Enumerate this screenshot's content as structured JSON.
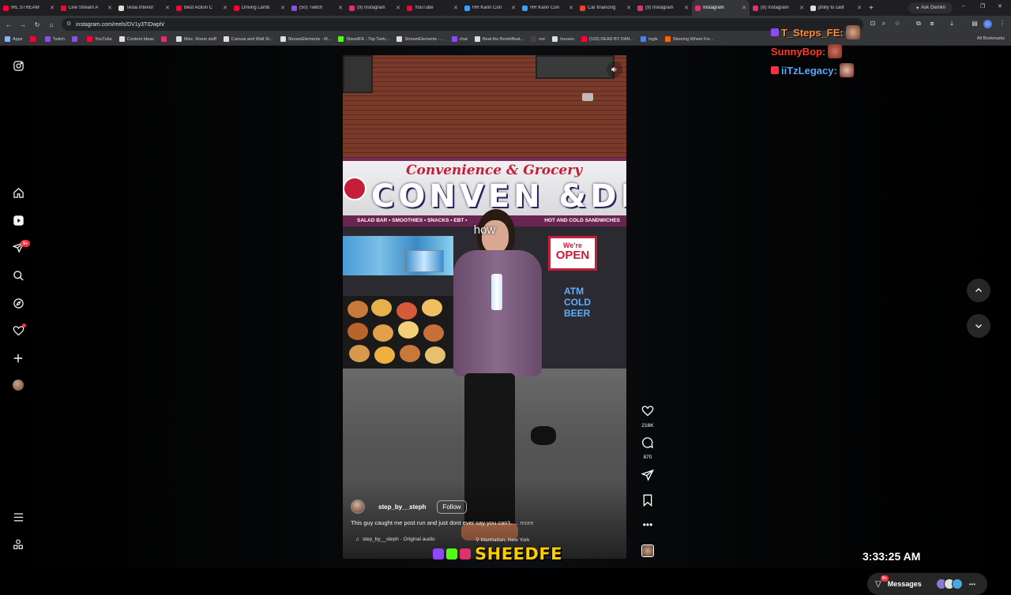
{
  "browser": {
    "tabs": [
      {
        "title": "IRL STREAM",
        "color": "#ff0033"
      },
      {
        "title": "Live Stream A",
        "color": "#ff0033"
      },
      {
        "title": "Tesla Interior",
        "color": "#dddddd"
      },
      {
        "title": "Best Action C",
        "color": "#ff0033"
      },
      {
        "title": "Driving Lamb",
        "color": "#ff0033"
      },
      {
        "title": "(50) Twitch",
        "color": "#9146ff"
      },
      {
        "title": "(9) Instagram",
        "color": "#e1306c"
      },
      {
        "title": "YouTube",
        "color": "#ff0033"
      },
      {
        "title": "HR Karin Con",
        "color": "#3aa0ff"
      },
      {
        "title": "HR Karin Con",
        "color": "#3aa0ff"
      },
      {
        "title": "Car financing",
        "color": "#ea4335"
      },
      {
        "title": "(9) Instagram",
        "color": "#e1306c"
      },
      {
        "title": "Instagram",
        "color": "#e1306c",
        "active": true
      },
      {
        "title": "(9) Instagram",
        "color": "#e1306c"
      },
      {
        "title": "philly to calif",
        "color": "#dddddd"
      }
    ],
    "ask_gemini": "Ask Gemini",
    "url": "instagram.com/reels/DV1y3TIDwph/",
    "bookmarks": [
      {
        "label": "Apps",
        "color": "#8ab4f8"
      },
      {
        "label": "",
        "color": "#ff0033"
      },
      {
        "label": "Twitch",
        "color": "#9146ff"
      },
      {
        "label": "",
        "color": "#9146ff"
      },
      {
        "label": "YouTube",
        "color": "#ff0033"
      },
      {
        "label": "Content Ideas",
        "color": "#dddddd"
      },
      {
        "label": "",
        "color": "#e1306c"
      },
      {
        "label": "Misc. Room stuff",
        "color": "#dddddd"
      },
      {
        "label": "Canvas and Wall St...",
        "color": "#dddddd"
      },
      {
        "label": "StreamElements - M...",
        "color": "#dddddd"
      },
      {
        "label": "SheedFE - Top Twitc...",
        "color": "#53fc18"
      },
      {
        "label": "StreamElements - ...",
        "color": "#dddddd"
      },
      {
        "label": "chat",
        "color": "#9146ff"
      },
      {
        "label": "Beat the BombBeat...",
        "color": "#dddddd"
      },
      {
        "label": "oor",
        "color": "#444444"
      },
      {
        "label": "houses",
        "color": "#dddddd"
      },
      {
        "label": "(103) DEAD BY DAN...",
        "color": "#ff0033"
      },
      {
        "label": "ingle",
        "color": "#4285f4"
      },
      {
        "label": "Steering Wheel For...",
        "color": "#ff6600"
      }
    ],
    "all_bookmarks": "All Bookmarks"
  },
  "sidenav": {
    "notifications_badge": "9+"
  },
  "reel": {
    "caption_word": "how",
    "awning_script": "Convenience & Grocery",
    "awning_big": "CONVEN &DE",
    "strip_left": "SALAD BAR • SMOOTHIES • SNACKS • EBT •",
    "strip_right": "HOT AND COLD SANDWICHES",
    "open_sign_top": "We're",
    "open_sign_main": "OPEN",
    "cold_beer": "ATM COLD BEER",
    "username": "step_by__steph",
    "follow_label": "Follow",
    "description": "This guy caught me post run and just dont ever say you can't. ...",
    "more_label": "more",
    "audio": "step_by__steph · Original audio",
    "location": "Manhattan, New York"
  },
  "actions": {
    "likes": "216K",
    "comments": "870"
  },
  "chat_overlay": [
    {
      "name": "T_Steps_FE:",
      "color": "#ff8a3a"
    },
    {
      "name": "SunnyBop:",
      "color": "#ff3a2a"
    },
    {
      "name": "iiTzLegacy:",
      "color": "#5aa8ff"
    }
  ],
  "messages": {
    "label": "Messages",
    "badge": "9+"
  },
  "stream": {
    "brand": "SHEEDFE",
    "clock": "3:33:25 AM"
  }
}
